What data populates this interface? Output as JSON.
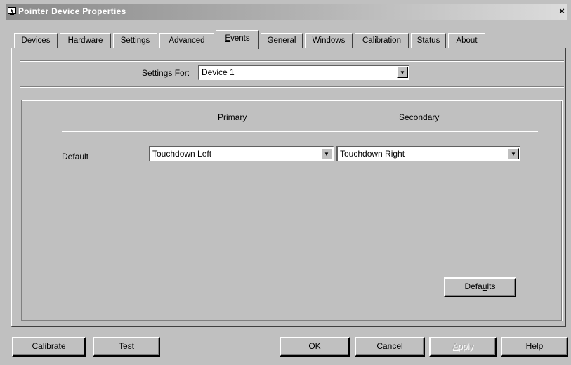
{
  "window": {
    "title": "Pointer Device Properties",
    "close_glyph": "×",
    "icon": "pointer-device-icon"
  },
  "tabs": [
    {
      "pre": "",
      "key": "D",
      "post": "evices",
      "active": false
    },
    {
      "pre": "",
      "key": "H",
      "post": "ardware",
      "active": false
    },
    {
      "pre": "",
      "key": "S",
      "post": "ettings",
      "active": false
    },
    {
      "pre": "Ad",
      "key": "v",
      "post": "anced",
      "active": false
    },
    {
      "pre": "",
      "key": "E",
      "post": "vents",
      "active": true
    },
    {
      "pre": "",
      "key": "G",
      "post": "eneral",
      "active": false
    },
    {
      "pre": "",
      "key": "W",
      "post": "indows",
      "active": false
    },
    {
      "pre": "Calibratio",
      "key": "n",
      "post": "",
      "active": false
    },
    {
      "pre": "Stat",
      "key": "u",
      "post": "s",
      "active": false
    },
    {
      "pre": "A",
      "key": "b",
      "post": "out",
      "active": false
    }
  ],
  "settings_for": {
    "label_pre": "Settings ",
    "label_key": "F",
    "label_post": "or:",
    "value": "Device 1"
  },
  "columns": {
    "primary": "Primary",
    "secondary": "Secondary"
  },
  "events": {
    "row_label": "Default",
    "primary_value": "Touchdown Left",
    "secondary_value": "Touchdown Right"
  },
  "buttons": {
    "defaults": {
      "pre": "Defa",
      "key": "u",
      "post": "lts"
    },
    "calibrate": {
      "pre": "",
      "key": "C",
      "post": "alibrate"
    },
    "test": {
      "pre": "",
      "key": "T",
      "post": "est"
    },
    "ok": "OK",
    "cancel": "Cancel",
    "apply": {
      "pre": "",
      "key": "A",
      "post": "pply"
    },
    "help": "Help"
  },
  "colors": {
    "face": "#c0c0c0",
    "titlebar_start": "#8a8a8a",
    "titlebar_end": "#dcdcdc"
  }
}
